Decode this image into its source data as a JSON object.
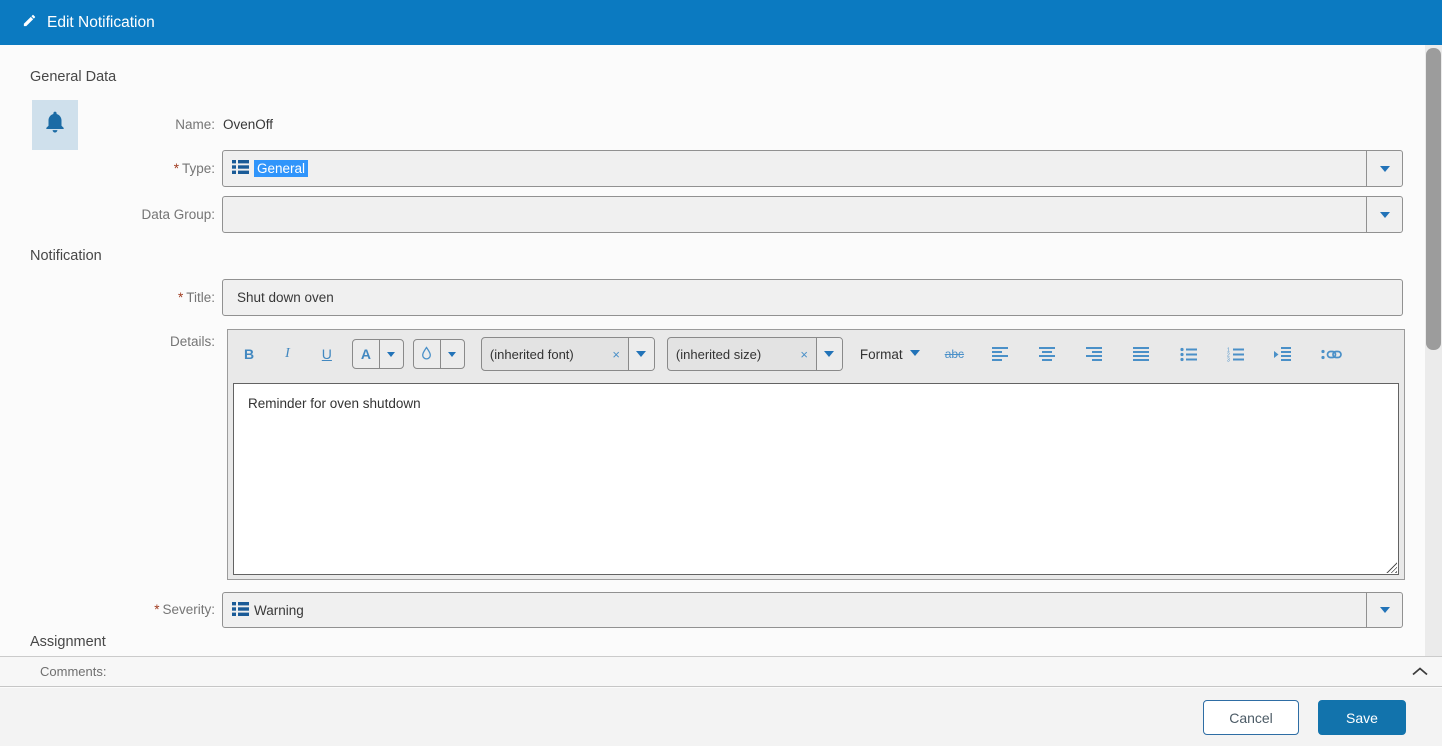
{
  "header": {
    "title": "Edit Notification"
  },
  "sections": {
    "general": "General Data",
    "notification": "Notification",
    "assignment": "Assignment"
  },
  "fields": {
    "name": {
      "label": "Name:",
      "value": "OvenOff"
    },
    "type": {
      "required_mark": "*",
      "label": "Type:",
      "value": "General"
    },
    "data_group": {
      "label": "Data Group:",
      "value": ""
    },
    "title": {
      "required_mark": "*",
      "label": "Title:",
      "value": "Shut down oven"
    },
    "details": {
      "label": "Details:",
      "text": "Reminder for oven shutdown"
    },
    "severity": {
      "required_mark": "*",
      "label": "Severity:",
      "value": "Warning"
    }
  },
  "toolbar": {
    "bold": "B",
    "italic": "I",
    "underline": "U",
    "font_color": "A",
    "font_combo": {
      "value": "(inherited font)",
      "clear": "×"
    },
    "size_combo": {
      "value": "(inherited size)",
      "clear": "×"
    },
    "format": "Format",
    "strike": "abc"
  },
  "comments": {
    "label": "Comments:"
  },
  "footer": {
    "cancel": "Cancel",
    "save": "Save"
  },
  "colors": {
    "header_bg": "#0b7ac1",
    "toolbar_icon_blue": "#4a90c8",
    "selection_blue": "#3095fb",
    "combo_icon_blue": "#1a5b97",
    "save_button_bg": "#1273ac",
    "cancel_border": "#2e6da4",
    "required_mark": "#a03c21",
    "field_bg": "#f0f0f0",
    "bell_tile_bg": "#cfe0ec"
  },
  "icons": [
    "pencil-icon",
    "bell-icon",
    "list-icon",
    "dropdown-arrow-icon",
    "font-color-icon",
    "highlight-droplet-icon",
    "clear-x-icon",
    "strikethrough-icon",
    "align-left-icon",
    "align-center-icon",
    "align-right-icon",
    "justify-icon",
    "bullet-list-icon",
    "numbered-list-icon",
    "indent-icon",
    "link-icon",
    "chevron-up-icon"
  ]
}
